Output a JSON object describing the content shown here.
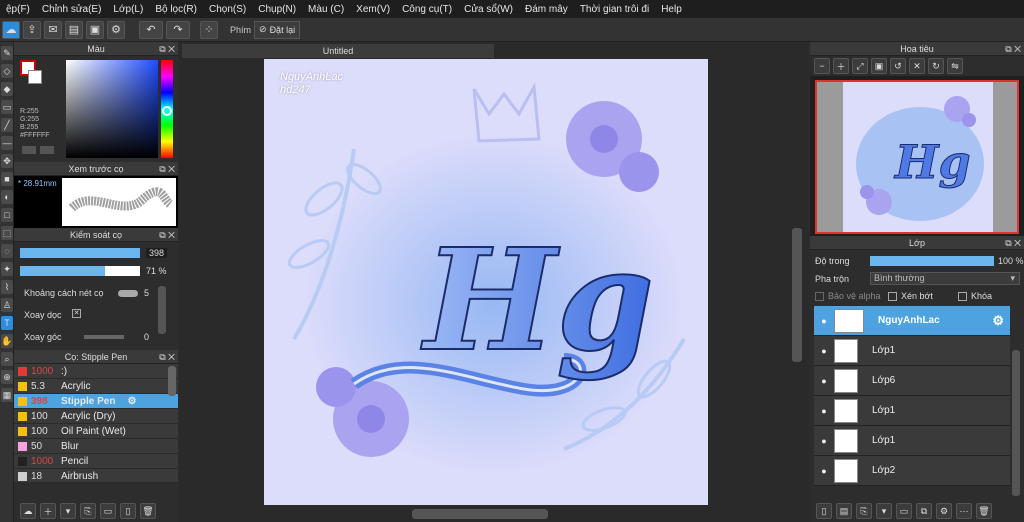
{
  "menu": [
    "ệp(F)",
    "Chỉnh sửa(E)",
    "Lớp(L)",
    "Bộ lọc(R)",
    "Chọn(S)",
    "Chụp(N)",
    "Màu (C)",
    "Xem(V)",
    "Công cụ(T)",
    "Cửa sổ(W)",
    "Đám mây",
    "Thời gian trôi đi",
    "Help"
  ],
  "toolbar": {
    "shortcut_label": "Phím",
    "reset_label": "Đặt lại"
  },
  "color_panel": {
    "title": "Màu",
    "r": "R:255",
    "g": "G:255",
    "b": "B:255",
    "hex": "#FFFFFF"
  },
  "brush_preview": {
    "title": "Xem trước cọ",
    "size": "* 28.91mm"
  },
  "brush_control": {
    "title": "Kiểm soát cọ",
    "size_value": "398",
    "opacity_value": "71 %",
    "spacing_label": "Khoảng cách nét cọ",
    "spacing_value": "5",
    "rotate_label": "Xoay dọc",
    "angle_label": "Xoay góc",
    "angle_value": "0"
  },
  "brush_list": {
    "title": "Cọ: Stipple Pen",
    "items": [
      {
        "size": "1000",
        "name": ":)",
        "color": "#e53935"
      },
      {
        "size": "5.3",
        "name": "Acrylic",
        "color": "#f4c20d"
      },
      {
        "size": "398",
        "name": "Stipple Pen",
        "color": "#f4c20d"
      },
      {
        "size": "100",
        "name": "Acrylic (Dry)",
        "color": "#f4c20d"
      },
      {
        "size": "100",
        "name": "Oil Paint (Wet)",
        "color": "#f4c20d"
      },
      {
        "size": "50",
        "name": "Blur",
        "color": "#f7a1e0"
      },
      {
        "size": "1000",
        "name": "Pencil",
        "color": "#222222"
      },
      {
        "size": "18",
        "name": "Airbrush",
        "color": "#cfcfcf"
      }
    ]
  },
  "canvas": {
    "tab_title": "Untitled",
    "watermark_name": "NguyAnhLac",
    "watermark_sub": "hd247",
    "lettering": "Hg"
  },
  "navigator": {
    "title": "Hoa tiêu"
  },
  "layers_panel": {
    "title": "Lớp",
    "opacity_label": "Độ trong",
    "opacity_value": "100 %",
    "opacity_fraction": 1.0,
    "blend_label": "Pha trộn",
    "blend_value": "Bình thường",
    "protect_alpha": "Bảo vệ alpha",
    "clip": "Xén bớt",
    "lock": "Khóa",
    "layers": [
      {
        "name": "NguyAnhLac",
        "selected": true
      },
      {
        "name": "Lớp1",
        "selected": false
      },
      {
        "name": "Lớp6",
        "selected": false
      },
      {
        "name": "Lớp1",
        "selected": false
      },
      {
        "name": "Lớp1",
        "selected": false
      },
      {
        "name": "Lớp2",
        "selected": false
      }
    ]
  },
  "colors": {
    "accent": "#4da3e0",
    "canvas_bg": "#dcdcfb"
  }
}
